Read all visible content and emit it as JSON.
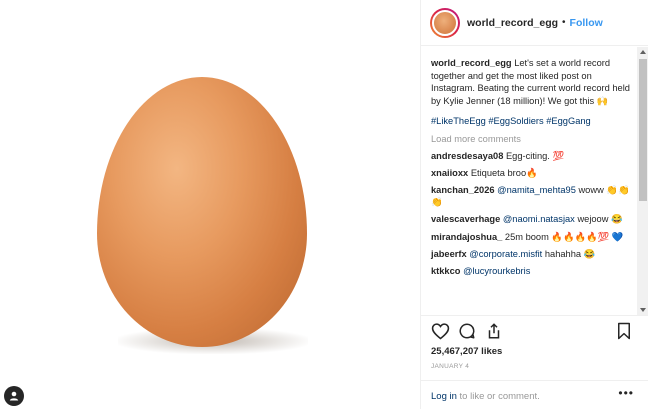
{
  "post": {
    "username": "world_record_egg",
    "separator": "•",
    "follow_label": "Follow"
  },
  "caption": {
    "username": "world_record_egg",
    "text": "Let's set a world record together and get the most liked post on Instagram. Beating the current world record held by Kylie Jenner (18 million)! We got this 🙌",
    "hashtags": "#LikeTheEgg #EggSoldiers #EggGang"
  },
  "load_more_label": "Load more comments",
  "comments": [
    {
      "user": "andresdesaya08",
      "mention": "",
      "text": "Egg-citing. 💯"
    },
    {
      "user": "xnaiioxx",
      "mention": "",
      "text": "Etiqueta broo🔥"
    },
    {
      "user": "kanchan_2026",
      "mention": "@namita_mehta95",
      "text": "woww 👏👏👏"
    },
    {
      "user": "valescaverhage",
      "mention": "@naomi.natasjax",
      "text": "wejoow 😂"
    },
    {
      "user": "mirandajoshua_",
      "mention": "",
      "text": "25m boom 🔥🔥🔥🔥💯 💙"
    },
    {
      "user": "jabeerfx",
      "mention": "@corporate.misfit",
      "text": "hahahha 😂"
    },
    {
      "user": "ktkkco",
      "mention": "@lucyrourkebris",
      "text": ""
    }
  ],
  "icons": {
    "like": "heart-icon",
    "comment": "comment-icon",
    "share": "share-icon",
    "save": "bookmark-icon",
    "profile": "profile-icon",
    "more": "more-options-icon"
  },
  "likes_count": "25,467,207 likes",
  "date": "JANUARY 4",
  "login": {
    "link": "Log in",
    "text": " to like or comment."
  },
  "more_label": "•••"
}
